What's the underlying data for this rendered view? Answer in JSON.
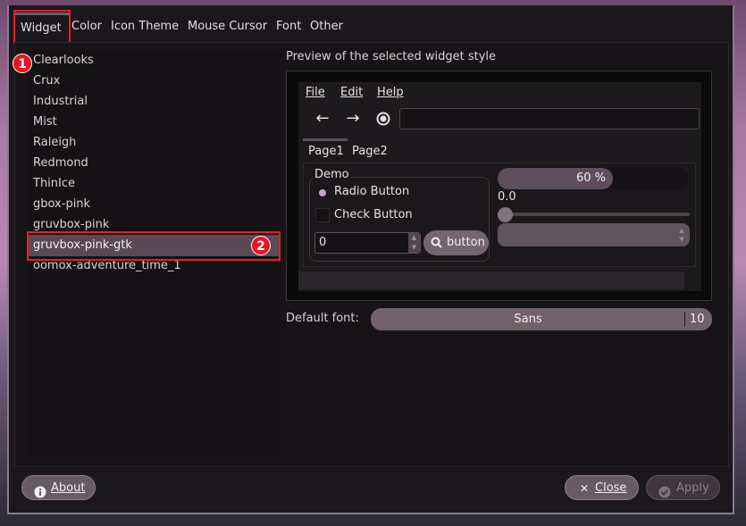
{
  "tabs": [
    "Widget",
    "Color",
    "Icon Theme",
    "Mouse Cursor",
    "Font",
    "Other"
  ],
  "themes": [
    "Clearlooks",
    "Crux",
    "Industrial",
    "Mist",
    "Raleigh",
    "Redmond",
    "ThinIce",
    "gbox-pink",
    "gruvbox-pink",
    "gruvbox-pink-gtk",
    "oomox-adventure_time_1"
  ],
  "selected_theme": "gruvbox-pink-gtk",
  "annotations": {
    "badge1": "1",
    "badge2": "2"
  },
  "preview": {
    "title": "Preview of the selected widget style",
    "menu": [
      "File",
      "Edit",
      "Help"
    ],
    "pages": [
      "Page1",
      "Page2"
    ],
    "demo_frame_label": "Demo",
    "radio_label": "Radio Button",
    "check_label": "Check Button",
    "spin_value": "0",
    "button_label": "button",
    "progress_value": 0.6,
    "progress_text": "60 %",
    "scale_value": "0.0"
  },
  "font": {
    "label": "Default font:",
    "name": "Sans",
    "size": "10"
  },
  "buttons": {
    "about": "About",
    "close": "Close",
    "apply": "Apply"
  },
  "icons": [
    "back-arrow-icon",
    "forward-arrow-icon",
    "record-icon",
    "search-icon",
    "info-icon",
    "close-x-icon",
    "checkmark-icon"
  ],
  "colors": {
    "accent": "#5b4956",
    "highlight": "#ee1c25",
    "window_bg": "#1a181b"
  }
}
